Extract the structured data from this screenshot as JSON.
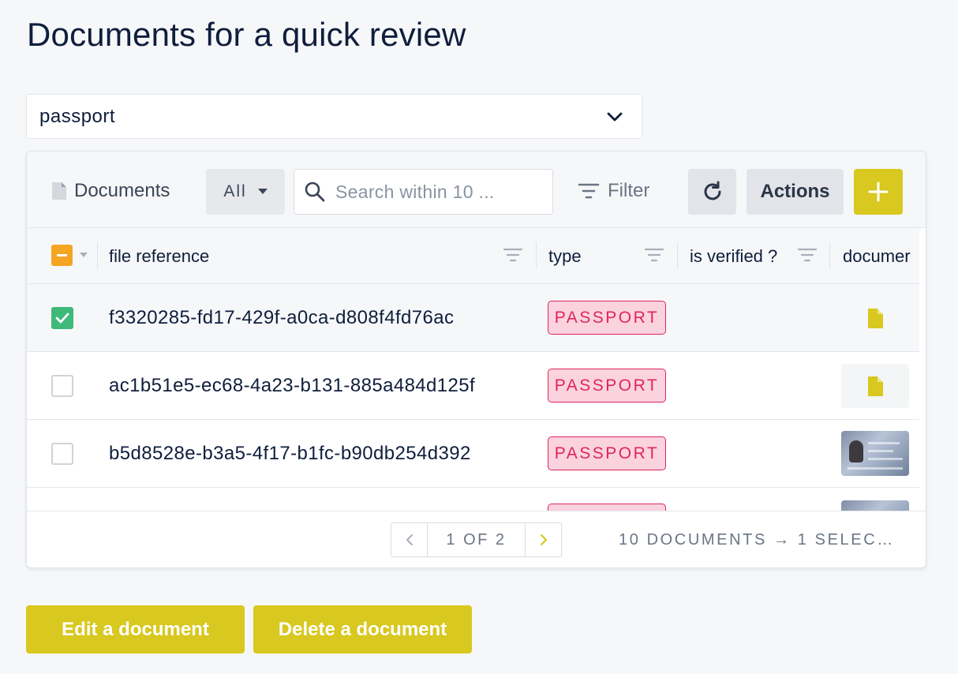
{
  "page": {
    "title": "Documents for a quick review"
  },
  "select": {
    "value": "passport"
  },
  "toolbar": {
    "title": "Documents",
    "all_label": "All",
    "search_placeholder": "Search within 10 ...",
    "filter_label": "Filter",
    "actions_label": "Actions"
  },
  "columns": {
    "file_reference": "file reference",
    "type": "type",
    "is_verified": "is verified ?",
    "document": "documer"
  },
  "rows": [
    {
      "ref": "f3320285-fd17-429f-a0ca-d808f4fd76ac",
      "type": "PASSPORT",
      "selected": true
    },
    {
      "ref": "ac1b51e5-ec68-4a23-b131-885a484d125f",
      "type": "PASSPORT",
      "selected": false
    },
    {
      "ref": "b5d8528e-b3a5-4f17-b1fc-b90db254d392",
      "type": "PASSPORT",
      "selected": false
    }
  ],
  "footer": {
    "page_label": "1 OF 2",
    "count_label": "10 DOCUMENTS → 1 SELEC…"
  },
  "buttons": {
    "edit": "Edit a document",
    "delete": "Delete a document"
  },
  "colors": {
    "accent": "#d8c81f",
    "badge_text": "#e0245e",
    "badge_bg": "#fbd3df",
    "check_on": "#3fb97a",
    "check_partial": "#f4a522"
  }
}
